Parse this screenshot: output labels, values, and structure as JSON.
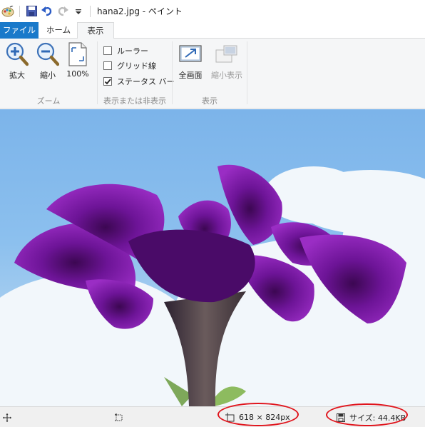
{
  "window": {
    "title": "hana2.jpg - ペイント"
  },
  "quick_access": {
    "icons": [
      "paint-app-icon",
      "save-icon",
      "undo-icon",
      "redo-icon",
      "customize-dropdown-icon"
    ]
  },
  "ribbon": {
    "tabs": [
      {
        "label": "ファイル",
        "active": false
      },
      {
        "label": "ホーム",
        "active": false
      },
      {
        "label": "表示",
        "active": true
      }
    ],
    "zoom_group": {
      "label": "ズーム",
      "zoom_in": "拡大",
      "zoom_out": "縮小",
      "zoom_100": "100%"
    },
    "show_hide_group": {
      "label": "表示または非表示",
      "ruler": {
        "label": "ルーラー",
        "checked": false
      },
      "gridlines": {
        "label": "グリッド線",
        "checked": false
      },
      "status_bar": {
        "label": "ステータス バー",
        "checked": true
      }
    },
    "display_group": {
      "label": "表示",
      "full_screen": "全画面",
      "thumbnail": "縮小表示",
      "thumbnail_enabled": false
    }
  },
  "status_bar": {
    "dimensions": "618 × 824px",
    "file_size": "サイズ: 44.4KB"
  },
  "colors": {
    "file_tab": "#1979ca",
    "annotation_ellipse": "#e0141c",
    "flower": "#8a1eb0",
    "sky": "#83b8e8"
  }
}
